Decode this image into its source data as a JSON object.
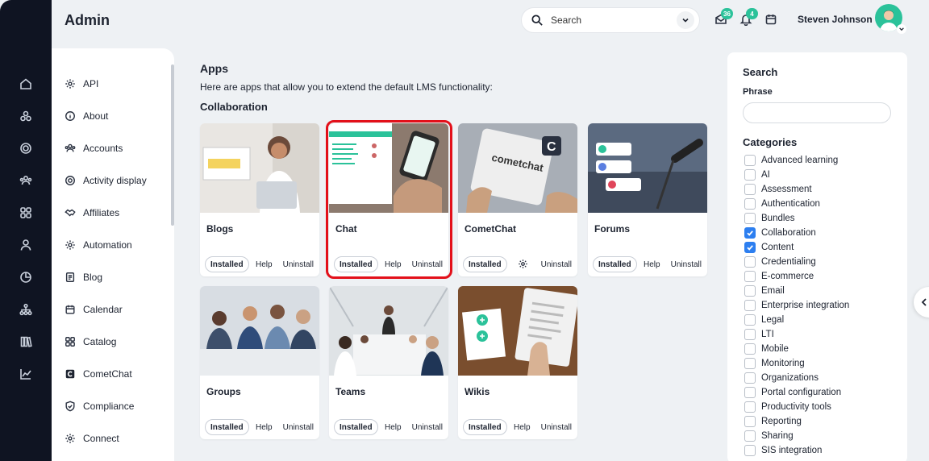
{
  "app": {
    "title": "Admin"
  },
  "search": {
    "placeholder": "Search"
  },
  "notifications": {
    "messages_count": "36",
    "alerts_count": "4"
  },
  "user": {
    "name": "Steven Johnson"
  },
  "rail_icons": [
    "home-icon",
    "modules-icon",
    "target-icon",
    "users-icon",
    "grid-icon",
    "person-icon",
    "chart-pie-icon",
    "hierarchy-icon",
    "library-icon",
    "trend-icon"
  ],
  "subnav": {
    "items": [
      {
        "label": "API",
        "icon": "gear-icon"
      },
      {
        "label": "About",
        "icon": "info-icon"
      },
      {
        "label": "Accounts",
        "icon": "users-icon"
      },
      {
        "label": "Activity display",
        "icon": "target-icon"
      },
      {
        "label": "Affiliates",
        "icon": "handshake-icon"
      },
      {
        "label": "Automation",
        "icon": "gear-icon"
      },
      {
        "label": "Blog",
        "icon": "document-icon"
      },
      {
        "label": "Calendar",
        "icon": "calendar-icon"
      },
      {
        "label": "Catalog",
        "icon": "grid-icon"
      },
      {
        "label": "CometChat",
        "icon": "cometchat-icon"
      },
      {
        "label": "Compliance",
        "icon": "shield-icon"
      },
      {
        "label": "Connect",
        "icon": "gear-icon"
      }
    ]
  },
  "main": {
    "title": "Apps",
    "description": "Here are apps that allow you to extend the default LMS functionality:",
    "section": "Collaboration",
    "cards": [
      {
        "name": "Blogs",
        "status": "Installed",
        "help": "Help",
        "uninstall": "Uninstall"
      },
      {
        "name": "Chat",
        "status": "Installed",
        "help": "Help",
        "uninstall": "Uninstall"
      },
      {
        "name": "CometChat",
        "status": "Installed",
        "help": "",
        "uninstall": "Uninstall"
      },
      {
        "name": "Forums",
        "status": "Installed",
        "help": "Help",
        "uninstall": "Uninstall"
      },
      {
        "name": "Groups",
        "status": "Installed",
        "help": "Help",
        "uninstall": "Uninstall"
      },
      {
        "name": "Teams",
        "status": "Installed",
        "help": "Help",
        "uninstall": "Uninstall"
      },
      {
        "name": "Wikis",
        "status": "Installed",
        "help": "Help",
        "uninstall": "Uninstall"
      }
    ],
    "cometchat_thumb_text": "cometchat",
    "cometchat_logo_letter": "C"
  },
  "filter": {
    "title": "Search",
    "phrase_label": "Phrase",
    "phrase_value": "",
    "categories_title": "Categories",
    "categories": [
      {
        "label": "Advanced learning",
        "checked": false
      },
      {
        "label": "AI",
        "checked": false
      },
      {
        "label": "Assessment",
        "checked": false
      },
      {
        "label": "Authentication",
        "checked": false
      },
      {
        "label": "Bundles",
        "checked": false
      },
      {
        "label": "Collaboration",
        "checked": true
      },
      {
        "label": "Content",
        "checked": true
      },
      {
        "label": "Credentialing",
        "checked": false
      },
      {
        "label": "E-commerce",
        "checked": false
      },
      {
        "label": "Email",
        "checked": false
      },
      {
        "label": "Enterprise integration",
        "checked": false
      },
      {
        "label": "Legal",
        "checked": false
      },
      {
        "label": "LTI",
        "checked": false
      },
      {
        "label": "Mobile",
        "checked": false
      },
      {
        "label": "Monitoring",
        "checked": false
      },
      {
        "label": "Organizations",
        "checked": false
      },
      {
        "label": "Portal configuration",
        "checked": false
      },
      {
        "label": "Productivity tools",
        "checked": false
      },
      {
        "label": "Reporting",
        "checked": false
      },
      {
        "label": "Sharing",
        "checked": false
      },
      {
        "label": "SIS integration",
        "checked": false
      }
    ]
  },
  "colors": {
    "accent": "#2bc29a",
    "highlight": "#e3101a",
    "checkbox": "#2d7ff0",
    "rail": "#0f1422"
  }
}
